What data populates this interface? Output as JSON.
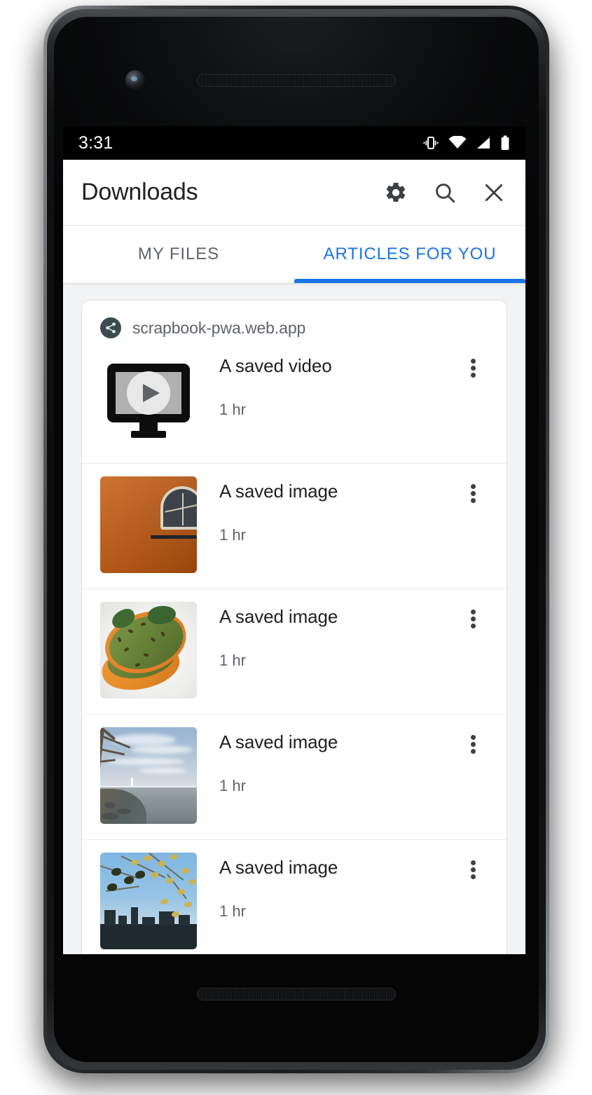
{
  "status_bar": {
    "time": "3:31",
    "icons": [
      "vibrate-icon",
      "wifi-icon",
      "cellular-signal-icon",
      "battery-icon"
    ]
  },
  "toolbar": {
    "title": "Downloads",
    "actions": [
      {
        "name": "settings-button",
        "icon": "gear-icon"
      },
      {
        "name": "search-button",
        "icon": "search-icon"
      },
      {
        "name": "close-button",
        "icon": "close-icon"
      }
    ]
  },
  "tabs": [
    {
      "label": "MY FILES",
      "active": false
    },
    {
      "label": "ARTICLES FOR YOU",
      "active": true
    }
  ],
  "colors": {
    "accent": "#1a73e8",
    "title_text": "#202124",
    "secondary_text": "#5f6368",
    "page_background": "#f1f3f4",
    "card_background": "#ffffff",
    "status_bar_background": "#000000"
  },
  "card": {
    "origin": "scrapbook-pwa.web.app",
    "origin_icon": "share-icon",
    "items": [
      {
        "title": "A saved video",
        "time": "1 hr",
        "thumbnail": "video-placeholder-icon",
        "menu_icon": "more-vertical-icon"
      },
      {
        "title": "A saved image",
        "time": "1 hr",
        "thumbnail": "orange-wall-arched-window-photo",
        "menu_icon": "more-vertical-icon"
      },
      {
        "title": "A saved image",
        "time": "1 hr",
        "thumbnail": "avocado-toast-plate-photo",
        "menu_icon": "more-vertical-icon"
      },
      {
        "title": "A saved image",
        "time": "1 hr",
        "thumbnail": "lakeshore-sky-photo",
        "menu_icon": "more-vertical-icon"
      },
      {
        "title": "A saved image",
        "time": "1 hr",
        "thumbnail": "city-skyline-autumn-leaves-photo",
        "menu_icon": "more-vertical-icon"
      }
    ]
  }
}
